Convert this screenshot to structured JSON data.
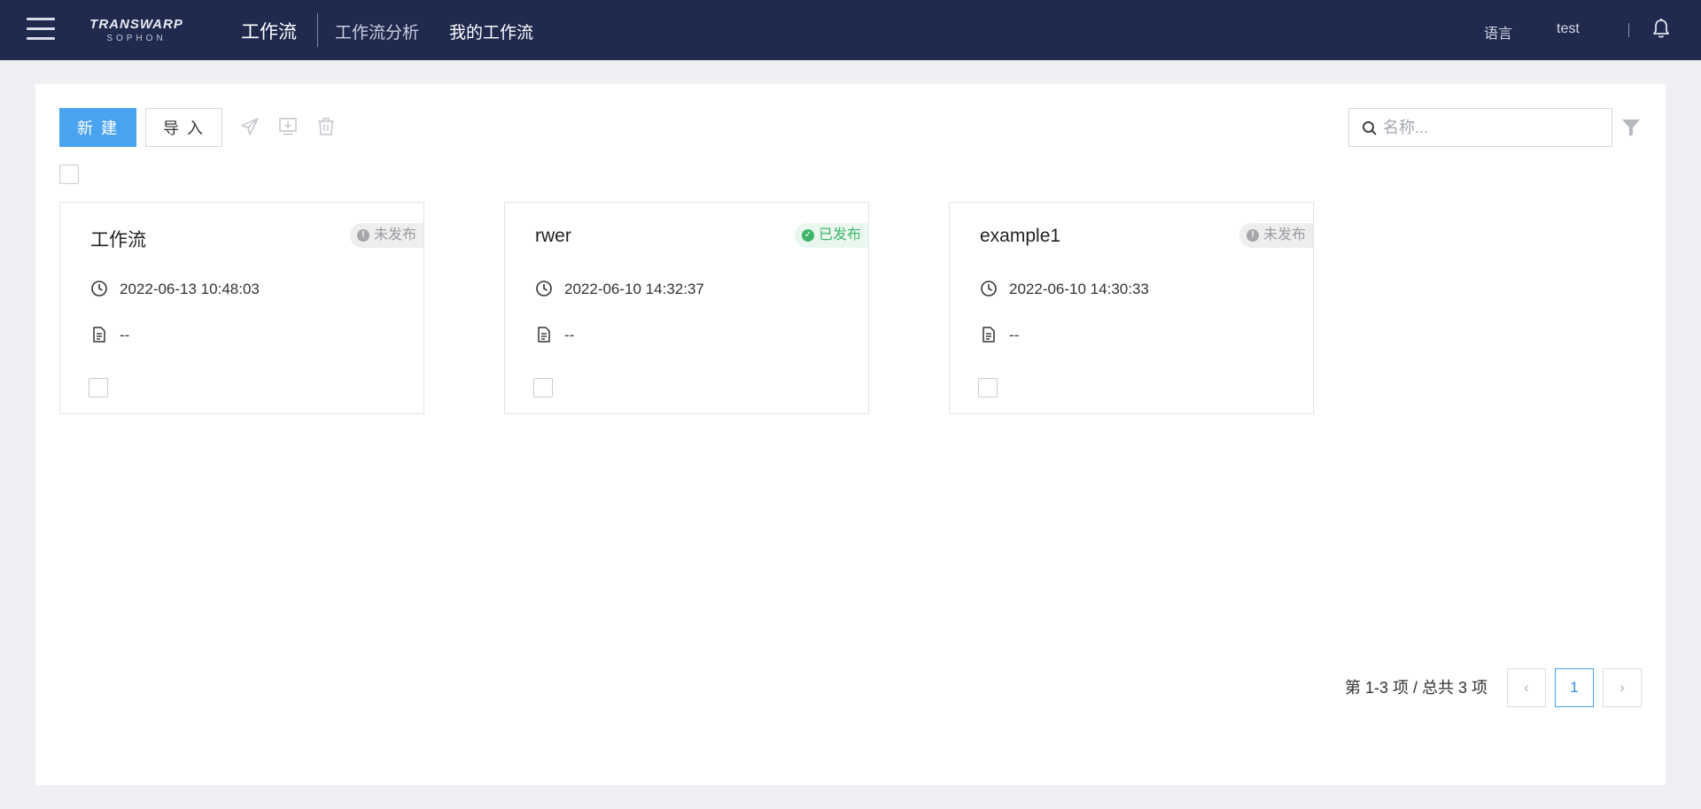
{
  "header": {
    "logo_main": "TRANSWARP",
    "logo_sub": "SOPHON",
    "app_title": "工作流",
    "tabs": [
      {
        "label": "工作流分析"
      },
      {
        "label": "我的工作流"
      }
    ],
    "language_label": "语言",
    "username": "test"
  },
  "toolbar": {
    "new_label": "新 建",
    "import_label": "导 入",
    "icons": [
      "publish-icon",
      "download-icon",
      "delete-icon"
    ],
    "search_placeholder": "名称...",
    "search_value": ""
  },
  "cards": [
    {
      "title": "工作流",
      "status": "未发布",
      "status_color": "#9a9ca1",
      "time": "2022-06-13 10:48:03",
      "description": "--"
    },
    {
      "title": "rwer",
      "status": "已发布",
      "status_color": "#3fb56b",
      "time": "2022-06-10 14:32:37",
      "description": "--"
    },
    {
      "title": "example1",
      "status": "未发布",
      "status_color": "#9a9ca1",
      "time": "2022-06-10 14:30:33",
      "description": "--"
    }
  ],
  "pagination": {
    "info": "第 1-3 项 / 总共 3 项",
    "current_page": "1",
    "prev_symbol": "‹",
    "next_symbol": "›"
  },
  "colors": {
    "header_bg": "#1f2a4e",
    "primary": "#4aa3ef",
    "page_bg": "#eef0f4"
  }
}
